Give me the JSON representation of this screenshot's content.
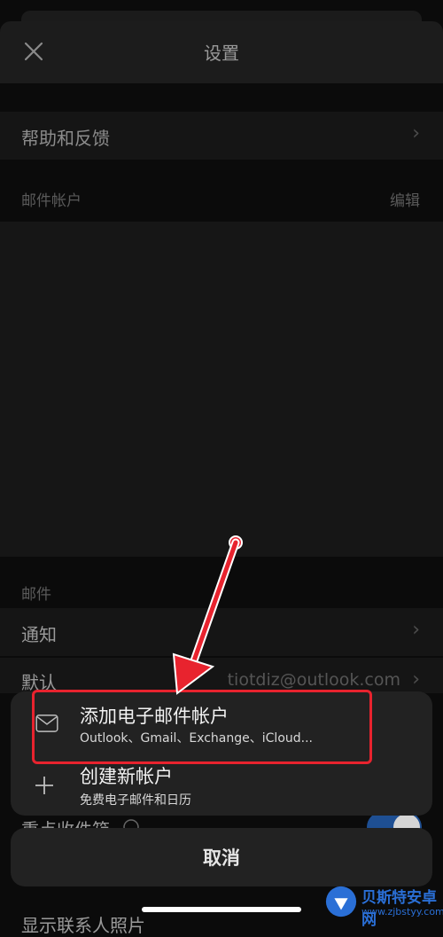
{
  "header": {
    "title": "设置"
  },
  "help_row": {
    "label": "帮助和反馈"
  },
  "accounts_section": {
    "label": "邮件帐户",
    "edit_label": "编辑"
  },
  "mail_section": {
    "label": "邮件",
    "notify_label": "通知",
    "default_label": "默认",
    "default_value": "tiotdiz@outlook.com",
    "focused_label": "重点收件箱",
    "photos_label": "显示联系人照片"
  },
  "action_sheet": {
    "add_account": {
      "title": "添加电子邮件帐户",
      "subtitle": "Outlook、Gmail、Exchange、iCloud..."
    },
    "create_account": {
      "title": "创建新帐户",
      "subtitle": "免费电子邮件和日历"
    },
    "cancel_label": "取消"
  },
  "annotation": {
    "highlight_color": "#e8232e"
  },
  "watermark": {
    "brand": "贝斯特安卓网",
    "url": "www.zjbstyy.com",
    "color": "#2a6fd6"
  },
  "icons": {
    "close": "close-icon",
    "chevron": "chevron-right-icon",
    "mail": "mail-icon",
    "plus": "plus-icon",
    "help": "question-circle-icon"
  }
}
